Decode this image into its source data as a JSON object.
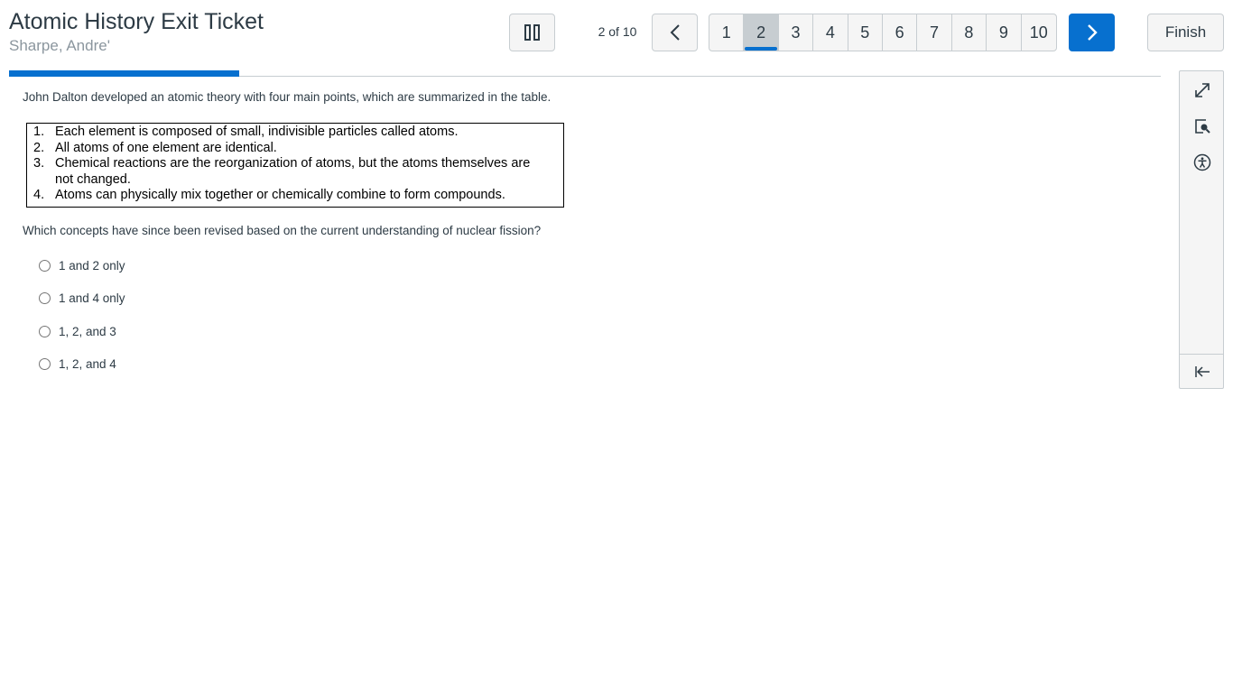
{
  "header": {
    "title": "Atomic History Exit Ticket",
    "student_name": "Sharpe, Andre'"
  },
  "navigation": {
    "counter": "2 of 10",
    "pause_icon": "pause-icon",
    "prev_icon": "chevron-left-icon",
    "next_icon": "chevron-right-icon",
    "pages": [
      "1",
      "2",
      "3",
      "4",
      "5",
      "6",
      "7",
      "8",
      "9",
      "10"
    ],
    "current_page": "2",
    "finish_label": "Finish"
  },
  "progress": {
    "current": 2,
    "total": 10,
    "fraction": 0.2,
    "color": "#0770cf"
  },
  "question": {
    "intro": "John Dalton developed an atomic theory with four main points, which are summarized in the table.",
    "dalton_points": [
      {
        "num": "1.",
        "text": "Each element is composed of small, indivisible particles called atoms."
      },
      {
        "num": "2.",
        "text": "All atoms of one element are identical."
      },
      {
        "num": "3.",
        "text": "Chemical reactions are the reorganization of atoms, but the atoms themselves are not changed."
      },
      {
        "num": "4.",
        "text": "Atoms can physically mix together or chemically combine to form compounds."
      }
    ],
    "prompt": "Which concepts have since been revised based on the current understanding of nuclear fission?",
    "options": [
      "1 and 2 only",
      "1 and 4 only",
      "1, 2, and 3",
      "1, 2, and 4"
    ],
    "selected": null
  },
  "sidebar": {
    "tools": [
      "expand-icon",
      "search-document-icon",
      "accessibility-icon"
    ],
    "collapse_icon": "collapse-panel-icon"
  },
  "colors": {
    "accent": "#0770cf",
    "text": "#2d3b45",
    "muted": "#8b969e",
    "border": "#c7cdd1"
  }
}
